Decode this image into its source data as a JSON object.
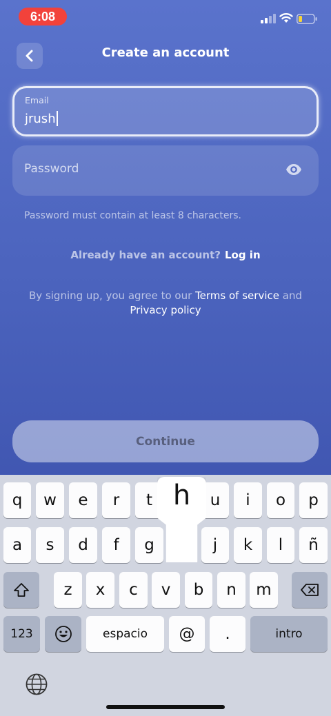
{
  "status_bar": {
    "time": "6:08",
    "icons": [
      "cellular-signal-icon",
      "wifi-icon",
      "battery-low-icon"
    ],
    "time_pill_color": "#f2423b"
  },
  "header": {
    "back_icon": "chevron-left-icon",
    "title": "Create an account"
  },
  "form": {
    "email": {
      "label": "Email",
      "value": "jrush"
    },
    "password": {
      "placeholder": "Password",
      "toggle_icon": "eye-icon"
    },
    "password_hint": "Password must contain at least 8 characters."
  },
  "login_prompt": {
    "question": "Already have an account?",
    "link": "Log in"
  },
  "terms": {
    "prefix": "By signing up, you agree to our",
    "terms_link": "Terms of service",
    "conjunction": "and",
    "privacy_link": "Privacy policy"
  },
  "continue_button": {
    "label": "Continue",
    "state": "disabled"
  },
  "keyboard": {
    "row1": [
      "q",
      "w",
      "e",
      "r",
      "t",
      "h",
      "u",
      "i",
      "o",
      "p"
    ],
    "row2": [
      "a",
      "s",
      "d",
      "f",
      "g",
      "",
      "j",
      "k",
      "l",
      "ñ"
    ],
    "row3": [
      "z",
      "x",
      "c",
      "v",
      "b",
      "n",
      "m"
    ],
    "numbers_key": "123",
    "emoji_icon": "emoji-icon",
    "space_key": "espacio",
    "at_key": "@",
    "period_key": ".",
    "return_key": "intro",
    "shift_icon": "shift-icon",
    "delete_icon": "backspace-icon",
    "globe_icon": "globe-icon",
    "pressed_key": "h"
  },
  "colors": {
    "background_top": "#5a73cc",
    "background_bottom": "#3a50aa",
    "keyboard_bg": "#d1d5e0"
  }
}
